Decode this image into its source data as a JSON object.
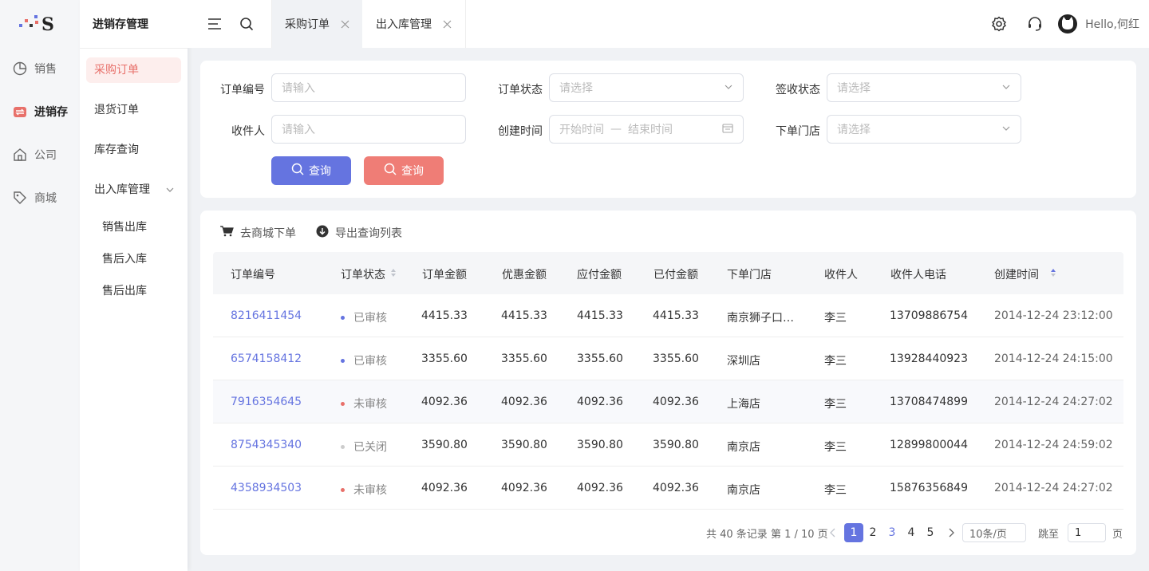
{
  "rail": {
    "items": [
      {
        "label": "销售",
        "icon": "pie-chart-icon"
      },
      {
        "label": "进销存",
        "icon": "inventory-icon"
      },
      {
        "label": "公司",
        "icon": "home-icon"
      },
      {
        "label": "商城",
        "icon": "tag-icon"
      }
    ],
    "active_color": "#e8706a"
  },
  "submenu": {
    "title": "进销存管理",
    "items": [
      "采购订单",
      "退货订单",
      "库存查询",
      "出入库管理"
    ],
    "children": [
      "销售出库",
      "售后入库",
      "售后出库"
    ]
  },
  "topbar": {
    "tabs": [
      {
        "label": "采购订单"
      },
      {
        "label": "出入库管理"
      }
    ],
    "greeting": "Hello,何红"
  },
  "filters": {
    "order_no_label": "订单编号",
    "order_no_placeholder": "请输入",
    "order_status_label": "订单状态",
    "order_status_placeholder": "请选择",
    "sign_status_label": "签收状态",
    "sign_status_placeholder": "请选择",
    "receiver_label": "收件人",
    "receiver_placeholder": "请输入",
    "created_label": "创建时间",
    "created_start": "开始时间",
    "created_sep": "—",
    "created_end": "结束时间",
    "store_label": "下单门店",
    "store_placeholder": "请选择",
    "query_label": "查询",
    "query2_label": "查询",
    "primary_color": "#6574e0",
    "secondary_color": "#ef7d76"
  },
  "toolbar": {
    "goto_mall": "去商城下单",
    "export": "导出查询列表"
  },
  "table": {
    "headers": [
      "订单编号",
      "订单状态",
      "订单金额",
      "优惠金额",
      "应付金额",
      "已付金额",
      "下单门店",
      "收件人",
      "收件人电话",
      "创建时间"
    ],
    "rows": [
      {
        "id": "8216411454",
        "status": "已审核",
        "status_color": "#6574e0",
        "amount": "4415.33",
        "discount": "4415.33",
        "payable": "4415.33",
        "paid": "4415.33",
        "store": "南京狮子口…",
        "receiver": "李三",
        "phone": "13709886754",
        "created": "2014-12-24  23:12:00"
      },
      {
        "id": "6574158412",
        "status": "已审核",
        "status_color": "#6574e0",
        "amount": "3355.60",
        "discount": "3355.60",
        "payable": "3355.60",
        "paid": "3355.60",
        "store": "深圳店",
        "receiver": "李三",
        "phone": "13928440923",
        "created": "2014-12-24  24:15:00"
      },
      {
        "id": "7916354645",
        "status": "未审核",
        "status_color": "#e8706a",
        "amount": "4092.36",
        "discount": "4092.36",
        "payable": "4092.36",
        "paid": "4092.36",
        "store": "上海店",
        "receiver": "李三",
        "phone": "13708474899",
        "created": "2014-12-24  24:27:02"
      },
      {
        "id": "8754345340",
        "status": "已关闭",
        "status_color": "#cccccc",
        "amount": "3590.80",
        "discount": "3590.80",
        "payable": "3590.80",
        "paid": "3590.80",
        "store": "南京店",
        "receiver": "李三",
        "phone": "12899800044",
        "created": "2014-12-24  24:59:02"
      },
      {
        "id": "4358934503",
        "status": "未审核",
        "status_color": "#e8706a",
        "amount": "4092.36",
        "discount": "4092.36",
        "payable": "4092.36",
        "paid": "4092.36",
        "store": "南京店",
        "receiver": "李三",
        "phone": "15876356849",
        "created": "2014-12-24  24:27:02"
      }
    ]
  },
  "pagination": {
    "summary": "共 40 条记录 第 1 / 10 页",
    "pages": [
      "1",
      "2",
      "3",
      "4",
      "5"
    ],
    "current": "1",
    "page_size": "10条/页",
    "jump_label": "跳至",
    "jump_value": "1",
    "page_unit": "页"
  }
}
